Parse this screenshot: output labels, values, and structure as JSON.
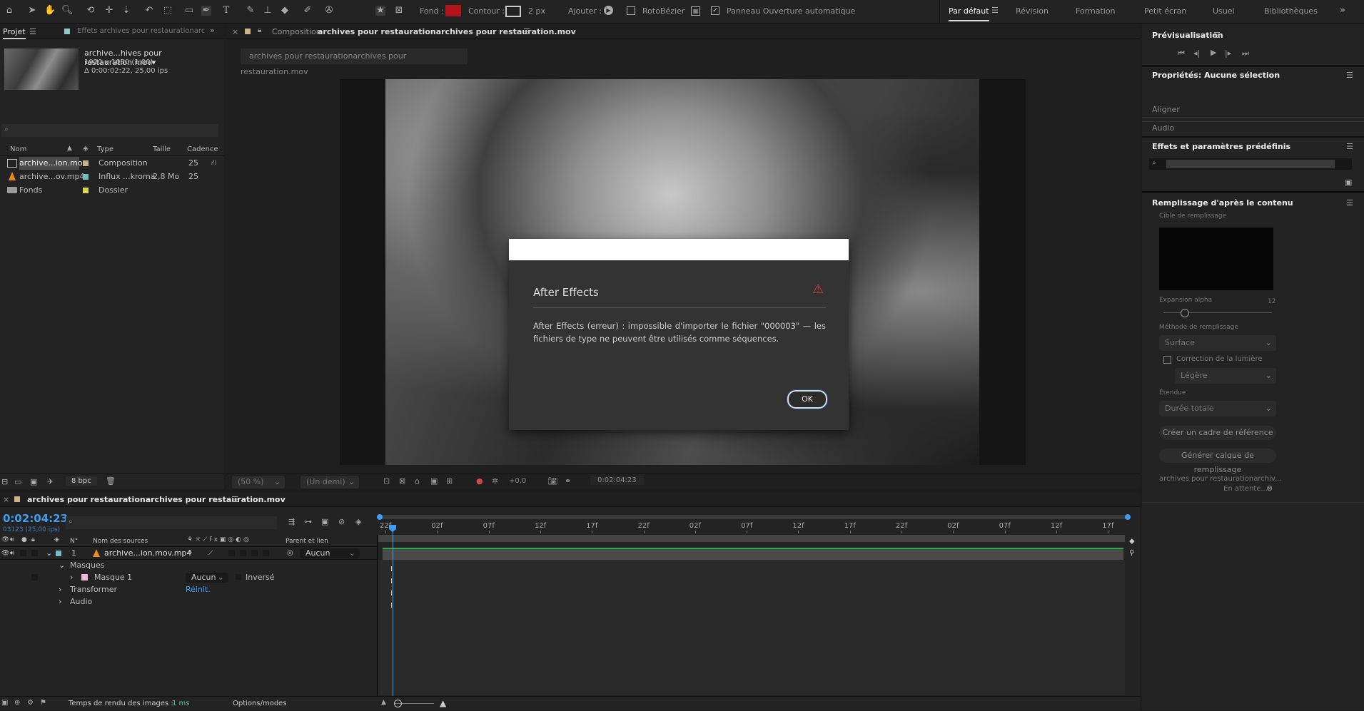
{
  "toolbar": {
    "fill_label": "Fond :",
    "fill_color": "#b3141a",
    "stroke_label": "Contour :",
    "stroke_size": "2 px",
    "add_label": "Ajouter :",
    "rotobezier_label": "RotoBézier",
    "panel_auto_label": "Panneau Ouverture automatique",
    "workspaces": [
      "Par défaut",
      "Révision",
      "Formation",
      "Petit écran",
      "Usuel",
      "Bibliothèques"
    ]
  },
  "project": {
    "tab_label": "Projet",
    "effects_tab": "Effets archives pour restaurationarchi",
    "item_name": "archive...hives pour restauration.mov▾",
    "item_res": "1920 x 1080 (1,00)",
    "item_dur": "Δ 0:00:02:22, 25,00 ips",
    "search_placeholder": "",
    "columns": {
      "name": "Nom",
      "type": "Type",
      "size": "Taille",
      "rate": "Cadence"
    },
    "rows": [
      {
        "name": "archive...ion.mov",
        "type": "Composition",
        "size": "",
        "rate": "25",
        "label_color": "#c9b38a"
      },
      {
        "name": "archive...ov.mp4",
        "type": "Influx ...kroma",
        "size": "2,8 Mo",
        "rate": "25",
        "label_color": "#7ab8c4"
      },
      {
        "name": "Fonds",
        "type": "Dossier",
        "size": "",
        "rate": "",
        "label_color": "#e0d44a"
      }
    ],
    "bpc": "8 bpc"
  },
  "composition": {
    "tab_prefix": "Composition",
    "tab_name": "archives pour restaurationarchives pour restauration.mov",
    "breadcrumb": "archives pour restaurationarchives pour restauration.mov",
    "zoom": "(50 %)",
    "resolution": "(Un demi)",
    "exposure": "+0,0",
    "timecode": "0:02:04:23"
  },
  "dialog": {
    "title": "After Effects",
    "message": "After Effects (erreur) : impossible d'importer le fichier \"000003\" — les fichiers de type  ne peuvent être utilisés comme séquences.",
    "ok_label": "OK"
  },
  "right": {
    "preview_label": "Prévisualisation",
    "properties_label": "Propriétés: Aucune sélection",
    "align_label": "Aligner",
    "audio_label": "Audio",
    "effects_label": "Effets et paramètres prédéfinis",
    "fill_label": "Remplissage d'après le contenu",
    "fill_target": "Cible de remplissage",
    "alpha_expansion": "Expansion alpha",
    "alpha_value": "12",
    "fill_method": "Méthode de remplissage",
    "method_value": "Surface",
    "light_correction": "Correction de la lumière",
    "light_value": "Légère",
    "range_label": "Étendue",
    "range_value": "Durée totale",
    "create_ref": "Créer un cadre de référence",
    "generate_layer": "Générer calque de remplissage",
    "status_name": "archives pour restaurationarchiv...",
    "status_wait": "En attente..."
  },
  "timeline": {
    "tab_name": "archives pour restaurationarchives pour restauration.mov",
    "timecode": "0:02:04:23",
    "frames": "03123 (25,00 ips)",
    "col_num": "N°",
    "col_source": "Nom des sources",
    "col_parent": "Parent et lien",
    "layer_num": "1",
    "layer_name": "archive...ion.mov.mp4",
    "parent_value": "Aucun",
    "masks_label": "Masques",
    "mask1_label": "Masque 1",
    "mask_mode": "Aucun",
    "inverted_label": "Inversé",
    "transform_label": "Transformer",
    "reset_label": "Réinit.",
    "audio_label": "Audio",
    "render_label": "Temps de rendu des images :",
    "render_value": "1 ms",
    "options_label": "Options/modes",
    "ruler_ticks": [
      "22f",
      "02f",
      "07f",
      "12f",
      "17f",
      "22f",
      "02f",
      "07f",
      "12f",
      "17f",
      "22f",
      "02f",
      "07f",
      "12f",
      "17f"
    ]
  }
}
